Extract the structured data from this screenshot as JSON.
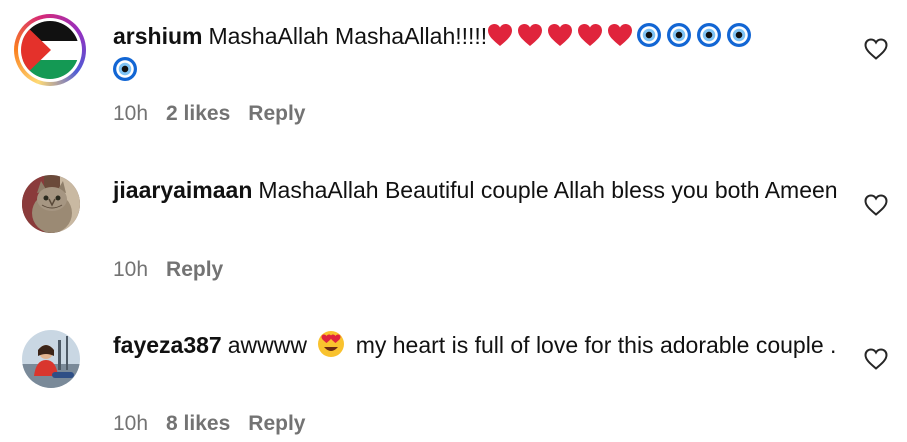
{
  "comments": [
    {
      "username": "arshium",
      "text": "MashaAllah MashaAllah!!!!!",
      "emojis": {
        "hearts": [
          "red-heart",
          "red-heart",
          "red-heart",
          "red-heart",
          "red-heart"
        ],
        "evil_eyes": [
          "nazar-amulet",
          "nazar-amulet",
          "nazar-amulet",
          "nazar-amulet",
          "nazar-amulet"
        ]
      },
      "time": "10h",
      "likes": "2 likes",
      "reply": "Reply",
      "avatar": "palestine-flag"
    },
    {
      "username": "jiaaryaimaan",
      "text": "MashaAllah Beautiful couple Allah bless you both Ameen",
      "time": "10h",
      "reply": "Reply",
      "avatar": "cat-photo"
    },
    {
      "username": "fayeza387",
      "text_before": "awwww",
      "emoji": "heart-eyes",
      "text_after": "my heart is full of love for this adorable couple .",
      "time": "10h",
      "likes": "8 likes",
      "reply": "Reply",
      "avatar": "person-photo"
    }
  ],
  "colors": {
    "text": "#111111",
    "meta": "#737373",
    "heart": "#e0243c",
    "evil_eye_blue": "#1266d4"
  },
  "icons": {
    "like": "heart-outline-icon"
  }
}
